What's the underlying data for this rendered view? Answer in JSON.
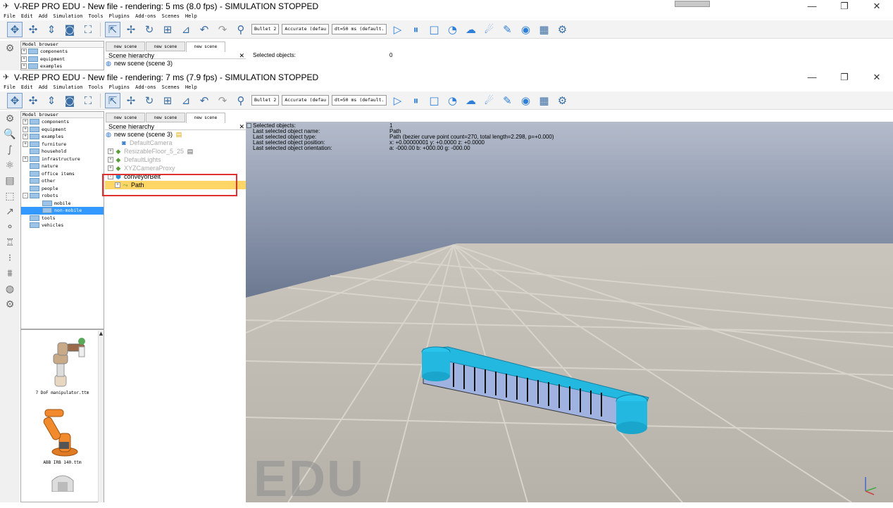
{
  "back_window": {
    "title": "V-REP PRO EDU - New file - rendering: 5 ms (8.0 fps) - SIMULATION STOPPED",
    "menu": [
      "File",
      "Edit",
      "Add",
      "Simulation",
      "Tools",
      "Plugins",
      "Add-ons",
      "Scenes",
      "Help"
    ],
    "browser_header": "Model browser",
    "tree": [
      "components",
      "equipment",
      "examples"
    ],
    "tabs": [
      "new scene",
      "new scene",
      "new scene"
    ],
    "hier_header": "Scene hierarchy",
    "hier_root": "new scene (scene 3)",
    "selected_label": "Selected objects:",
    "selected_value": "0"
  },
  "front_window": {
    "title": "V-REP PRO EDU - New file - rendering: 7 ms (7.9 fps) - SIMULATION STOPPED",
    "menu": [
      "File",
      "Edit",
      "Add",
      "Simulation",
      "Tools",
      "Plugins",
      "Add-ons",
      "Scenes",
      "Help"
    ],
    "toolbar": {
      "engine": "Bullet 2",
      "accuracy": "Accurate (defau",
      "dt": "dt=50 ms (default."
    },
    "browser_header": "Model browser",
    "tree": [
      {
        "label": "components",
        "exp": "+"
      },
      {
        "label": "equipment",
        "exp": "+"
      },
      {
        "label": "examples",
        "exp": "+"
      },
      {
        "label": "furniture",
        "exp": "+"
      },
      {
        "label": "household",
        "exp": ""
      },
      {
        "label": "infrastructure",
        "exp": "+"
      },
      {
        "label": "nature",
        "exp": ""
      },
      {
        "label": "office items",
        "exp": ""
      },
      {
        "label": "other",
        "exp": ""
      },
      {
        "label": "people",
        "exp": ""
      },
      {
        "label": "robots",
        "exp": "-"
      },
      {
        "label": "mobile",
        "exp": "child"
      },
      {
        "label": "non-mobile",
        "exp": "child-sel"
      },
      {
        "label": "tools",
        "exp": ""
      },
      {
        "label": "vehicles",
        "exp": ""
      }
    ],
    "tabs": [
      "new scene",
      "new scene",
      "new scene"
    ],
    "hier_header": "Scene hierarchy",
    "hierarchy": [
      {
        "label": "new scene (scene 3)",
        "cls": "root"
      },
      {
        "label": "DefaultCamera",
        "cls": "gray"
      },
      {
        "label": "ResizableFloor_5_25",
        "cls": "gray"
      },
      {
        "label": "DefaultLights",
        "cls": "gray"
      },
      {
        "label": "XYZCameraProxy",
        "cls": "gray"
      },
      {
        "label": "conveyorBelt",
        "cls": "normal"
      },
      {
        "label": "Path",
        "cls": "sel"
      }
    ],
    "info": {
      "labels": [
        "Selected objects:",
        "Last selected object name:",
        "Last selected object type:",
        "Last selected object position:",
        "Last selected object orientation:"
      ],
      "values": [
        "1",
        "Path",
        "Path (bezier curve point count=270, total length=2.298, p=+0.000)",
        "x: +0.00000001   y: +0.0000   z: +0.0000",
        "a: -000.00   b: +000.00   g: -000.00"
      ]
    },
    "models": [
      "7 DoF manipulator.ttm",
      "ABB IRB 140.ttm"
    ],
    "watermark": "EDU",
    "colors": {
      "selection": "#3399ff",
      "hier_selection": "#ffd666",
      "highlight_box": "#e03030",
      "belt": "#22b8e0"
    }
  }
}
